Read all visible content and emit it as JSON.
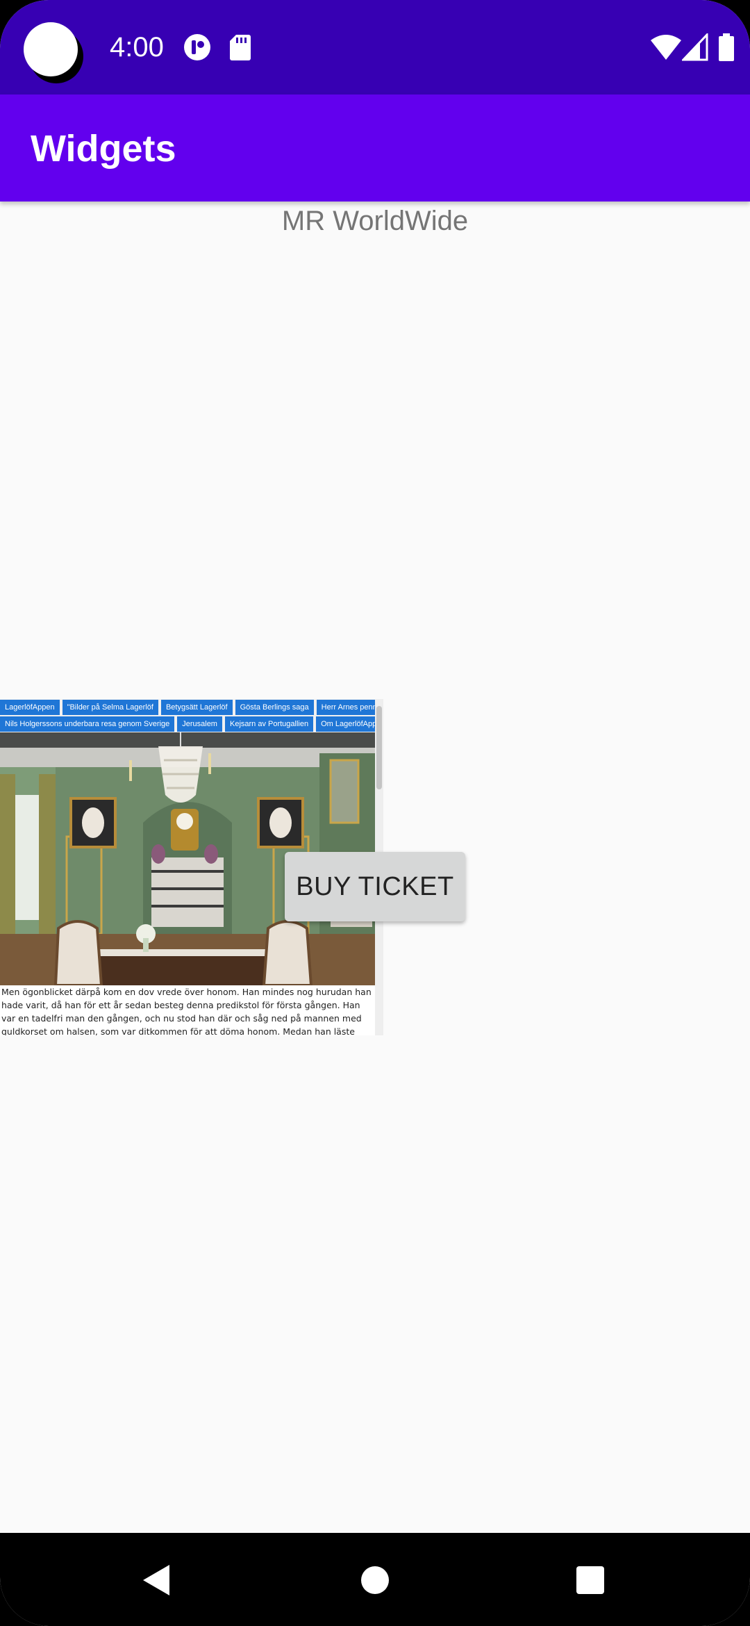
{
  "status_bar": {
    "time": "4:00",
    "icons": [
      "camera-cutout-icon",
      "notification-app-icon",
      "sd-card-icon",
      "wifi-icon",
      "cell-signal-icon",
      "battery-icon"
    ]
  },
  "app_bar": {
    "title": "Widgets"
  },
  "content": {
    "subtitle": "MR WorldWide",
    "webview": {
      "nav_tabs_row1": [
        "LagerlöfAppen",
        "\"Bilder på Selma Lagerlöf",
        "Betygsätt Lagerlöf",
        "Gösta Berlings saga",
        "Herr Arnes penningar"
      ],
      "nav_tabs_row2": [
        "Nils Holgerssons underbara resa genom Sverige",
        "Jerusalem",
        "Kejsarn av Portugallien",
        "Om LagerlöfAppen"
      ],
      "body_text": "Men ögonblicket därpå kom en dov vrede över honom. Han mindes nog hurudan han hade varit, då han för ett år sedan besteg denna predikstol för första gången. Han var en tadelfri man den gången, och nu stod han där och såg ned på mannen med guldkorset om halsen, som var ditkommen för att döma honom. Medan han läste upp inledningen, sköljde blodvåg efter"
    },
    "buy_button": "BUY TICKET"
  },
  "nav_bar": {
    "icons": [
      "back-icon",
      "home-icon",
      "recents-icon"
    ]
  },
  "colors": {
    "status_bar": "#3700b3",
    "app_bar": "#6200ee",
    "background": "#fafafa",
    "button": "#d6d7d7"
  }
}
